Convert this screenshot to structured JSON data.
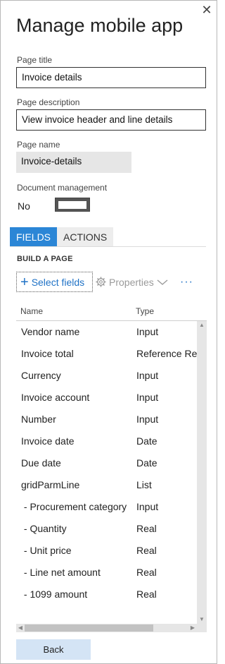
{
  "dialog": {
    "title": "Manage mobile app",
    "close_label": "✕"
  },
  "page_title": {
    "label": "Page title",
    "value": "Invoice details"
  },
  "page_description": {
    "label": "Page description",
    "value": "View invoice header and line details"
  },
  "page_name": {
    "label": "Page name",
    "value": "Invoice-details"
  },
  "document_management": {
    "label": "Document management",
    "value": "No"
  },
  "tabs": [
    {
      "label": "FIELDS",
      "active": true
    },
    {
      "label": "ACTIONS",
      "active": false
    }
  ],
  "build": {
    "heading": "BUILD A PAGE",
    "select_fields": "Select fields",
    "properties": "Properties",
    "more": "···"
  },
  "grid": {
    "columns": [
      "Name",
      "Type"
    ],
    "rows": [
      [
        "Vendor name",
        "Input"
      ],
      [
        "Invoice total",
        "Reference Real"
      ],
      [
        "Currency",
        "Input"
      ],
      [
        "Invoice account",
        "Input"
      ],
      [
        "Number",
        "Input"
      ],
      [
        "Invoice date",
        "Date"
      ],
      [
        "Due date",
        "Date"
      ],
      [
        "gridParmLine",
        "List"
      ],
      [
        " - Procurement category",
        "Input"
      ],
      [
        " - Quantity",
        "Real"
      ],
      [
        " - Unit price",
        "Real"
      ],
      [
        " - Line net amount",
        "Real"
      ],
      [
        " - 1099 amount",
        "Real"
      ]
    ]
  },
  "footer": {
    "back_label": "Back"
  },
  "colors": {
    "accent": "#2b86d6",
    "link": "#1f72c6",
    "back_bg": "#d4e4f5"
  }
}
